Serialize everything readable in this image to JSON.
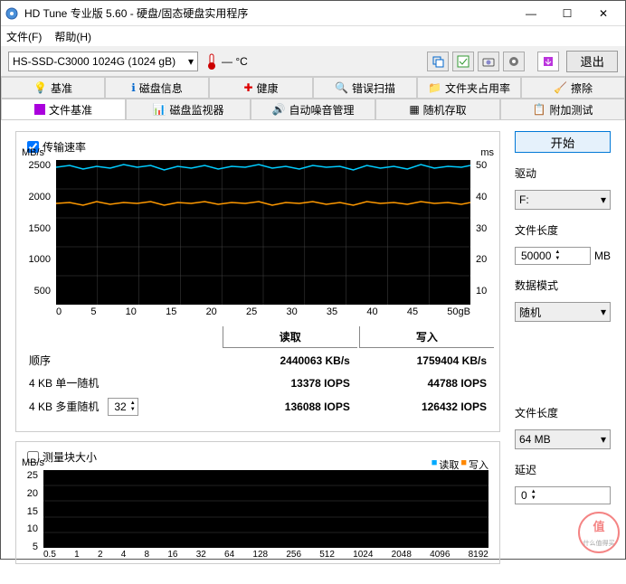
{
  "window": {
    "title": "HD Tune 专业版 5.60 - 硬盘/固态硬盘实用程序"
  },
  "menu": {
    "file": "文件(F)",
    "help": "帮助(H)"
  },
  "toolbar": {
    "drive": "HS-SSD-C3000 1024G (1024 gB)",
    "temp": "— °C",
    "exit": "退出"
  },
  "tabs_row1": [
    "基准",
    "磁盘信息",
    "健康",
    "错误扫描",
    "文件夹占用率",
    "擦除"
  ],
  "tabs_row2": [
    "文件基准",
    "磁盘监视器",
    "自动噪音管理",
    "随机存取",
    "附加测试"
  ],
  "active_tab": "文件基准",
  "panel1": {
    "checkbox": "传输速率",
    "y_unit_left": "MB/s",
    "y_unit_right": "ms",
    "y_left": [
      "2500",
      "2000",
      "1500",
      "1000",
      "500",
      ""
    ],
    "y_right": [
      "50",
      "40",
      "30",
      "20",
      "10",
      ""
    ],
    "x": [
      "0",
      "5",
      "10",
      "15",
      "20",
      "25",
      "30",
      "35",
      "40",
      "45",
      "50gB"
    ]
  },
  "results": {
    "head_read": "读取",
    "head_write": "写入",
    "rows": [
      {
        "label": "顺序",
        "read": "2440063 KB/s",
        "write": "1759404 KB/s"
      },
      {
        "label": "4 KB 单一随机",
        "read": "13378 IOPS",
        "write": "44788 IOPS"
      },
      {
        "label": "4 KB 多重随机",
        "read": "136088 IOPS",
        "write": "126432 IOPS"
      }
    ],
    "spinner": "32"
  },
  "panel2": {
    "checkbox": "测量块大小",
    "y_unit": "MB/s",
    "y": [
      "25",
      "20",
      "15",
      "10",
      "5",
      ""
    ],
    "x": [
      "0.5",
      "1",
      "2",
      "4",
      "8",
      "16",
      "32",
      "64",
      "128",
      "256",
      "512",
      "1024",
      "2048",
      "4096",
      "8192"
    ],
    "legend_read": "读取",
    "legend_write": "写入"
  },
  "side": {
    "start": "开始",
    "drive_lbl": "驱动",
    "drive_val": "F:",
    "filelen_lbl": "文件长度",
    "filelen_val": "50000",
    "filelen_unit": "MB",
    "datamode_lbl": "数据模式",
    "datamode_val": "随机",
    "filelen2_lbl": "文件长度",
    "filelen2_val": "64 MB",
    "delay_lbl": "延迟",
    "delay_val": "0"
  },
  "chart_data": {
    "type": "line",
    "title": "传输速率",
    "xlabel": "gB",
    "ylabel_left": "MB/s",
    "ylabel_right": "ms",
    "xlim": [
      0,
      50
    ],
    "ylim_left": [
      0,
      2500
    ],
    "ylim_right": [
      0,
      50
    ],
    "series": [
      {
        "name": "读取",
        "axis": "left",
        "approx_mean": 2400,
        "approx_range": [
          2300,
          2480
        ]
      },
      {
        "name": "写入",
        "axis": "left",
        "approx_mean": 1750,
        "approx_range": [
          1700,
          1820
        ]
      }
    ]
  }
}
